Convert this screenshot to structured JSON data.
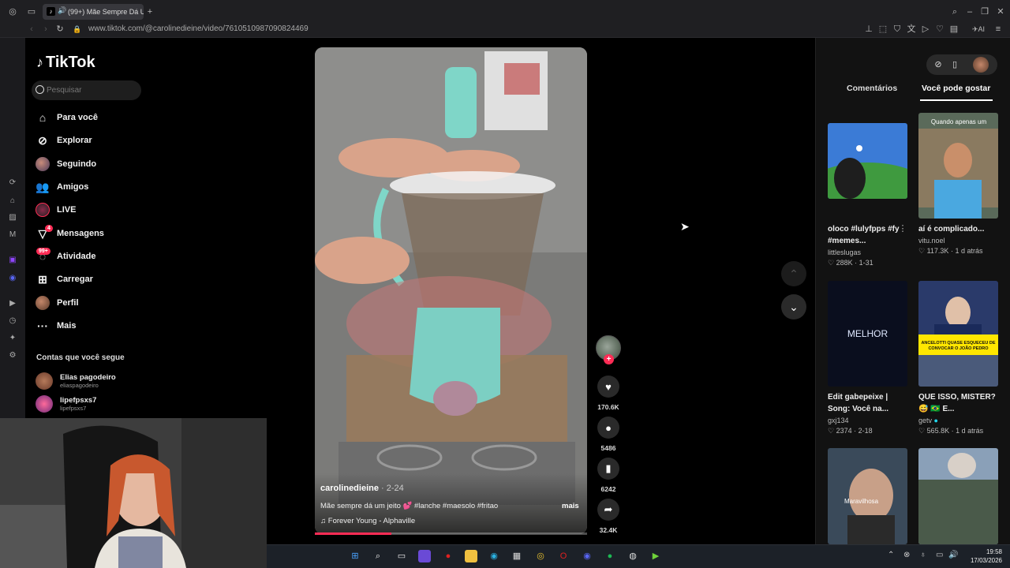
{
  "browser": {
    "tab_title": "(99+) Mãe Sempre Dá U",
    "url": "www.tiktok.com/@carolinedieine/video/7610510987090824469",
    "new_tab": "+"
  },
  "tiktok": {
    "logo": "TikTok",
    "search_placeholder": "Pesquisar",
    "nav": [
      {
        "label": "Para você",
        "icon": "home-icon"
      },
      {
        "label": "Explorar",
        "icon": "compass-icon"
      },
      {
        "label": "Seguindo",
        "icon": "following-avatar-icon"
      },
      {
        "label": "Amigos",
        "icon": "friends-icon"
      },
      {
        "label": "LIVE",
        "icon": "live-icon"
      },
      {
        "label": "Mensagens",
        "icon": "messages-icon",
        "badge": "4"
      },
      {
        "label": "Atividade",
        "icon": "activity-icon",
        "badge": "99+"
      },
      {
        "label": "Carregar",
        "icon": "upload-icon"
      },
      {
        "label": "Perfil",
        "icon": "profile-avatar-icon"
      },
      {
        "label": "Mais",
        "icon": "more-icon"
      }
    ],
    "following_title": "Contas que você segue",
    "following": [
      {
        "name": "Elias pagodeiro",
        "handle": "eliaspagodeiro"
      },
      {
        "name": "lipefpsxs7",
        "handle": "lipefpsxs7"
      }
    ]
  },
  "video": {
    "author": "carolinedieine",
    "date": " · 2-24",
    "description": "Mãe sempre dá um jeito 💕 #lanche #maesolo #fritao",
    "more": "mais",
    "music": "Forever Young - Alphaville",
    "likes": "170.6K",
    "comments": "5486",
    "saves": "6242",
    "shares": "32.4K",
    "progress": 0.28
  },
  "right_panel": {
    "tab_comments": "Comentários",
    "tab_suggested": "Você pode gostar",
    "cards": [
      {
        "title": "oloco #lulyfpps #fy #memes...",
        "user": "littleslugas",
        "likes": "288K",
        "date": "1-31",
        "thumb_text": ""
      },
      {
        "title": "aí é complicado...",
        "user": "vitu.noel",
        "likes": "117.3K",
        "date": "1 d atrás",
        "thumb_text": "Quando apenas um"
      },
      {
        "title": "Edit gabepeixe | Song: Você na...",
        "user": "gxj134",
        "likes": "2374",
        "date": "2-18",
        "thumb_text": "MELHOR"
      },
      {
        "title": "QUE ISSO, MISTER? 😅 🇧🇷 E...",
        "user": "getv",
        "likes": "565.8K",
        "date": "1 d atrás",
        "thumb_text": "ANCELOTTI QUASE ESQUECEU DE CONVOCAR O JOÃO PEDRO"
      },
      {
        "title": "",
        "user": "",
        "likes": "",
        "date": "",
        "thumb_text": "Maravilhosa"
      },
      {
        "title": "",
        "user": "",
        "likes": "",
        "date": "",
        "thumb_text": ""
      }
    ]
  },
  "taskbar": {
    "time": "19:58",
    "date": "17/03/2026"
  },
  "colors": {
    "accent": "#fe2c55",
    "background": "#000000",
    "panel": "#121212"
  }
}
